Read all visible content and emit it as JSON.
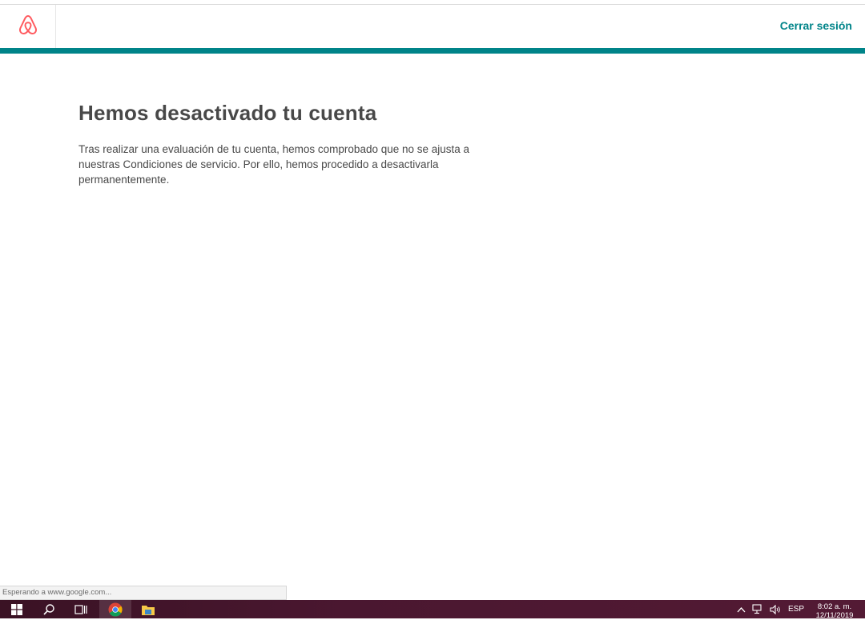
{
  "header": {
    "logo_icon": "airbnb-belo-icon",
    "logout_label": "Cerrar sesión",
    "accent_color": "#008489",
    "logo_color": "#ff5a5f"
  },
  "main": {
    "title": "Hemos desactivado tu cuenta",
    "message": "Tras realizar una evaluación de tu cuenta, hemos comprobado que no se ajusta a nuestras Condiciones de servicio. Por ello, hemos procedido a desactivarla permanentemente."
  },
  "browser_status": {
    "text": "Esperando a www.google.com..."
  },
  "taskbar": {
    "icons": [
      "windows-start-icon",
      "search-icon",
      "task-view-icon",
      "chrome-icon",
      "file-explorer-icon"
    ],
    "tray": {
      "chevron_icon": "chevron-up-icon",
      "network_icon": "network-icon",
      "volume_icon": "volume-icon",
      "language": "ESP",
      "time": "8:02 a. m.",
      "date": "12/11/2019"
    }
  }
}
